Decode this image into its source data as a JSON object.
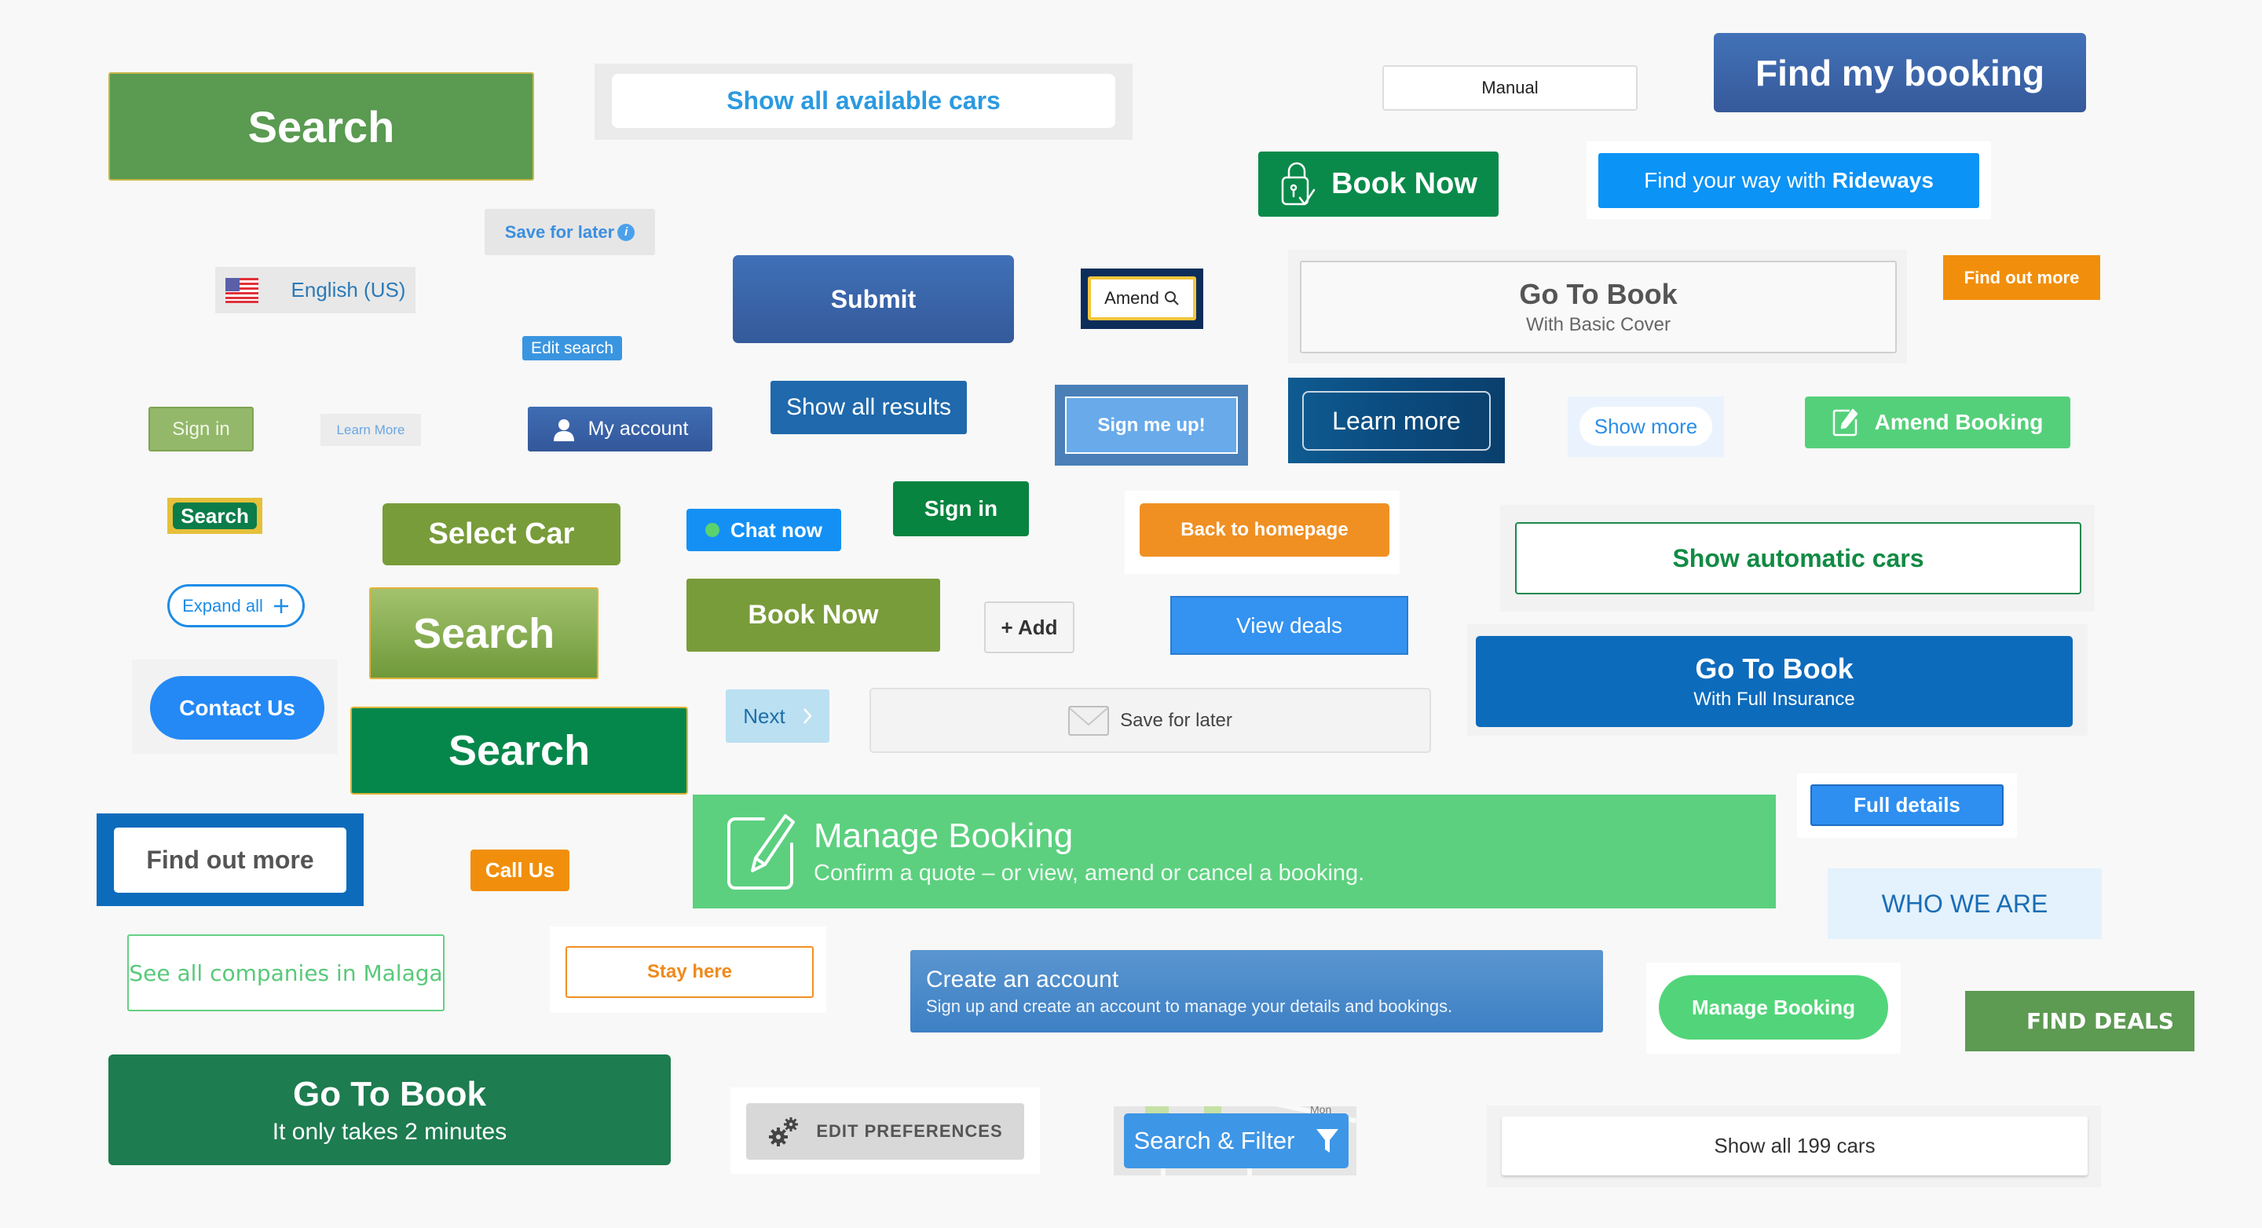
{
  "buttons": {
    "search_large": "Search",
    "show_all_available_cars": "Show all available cars",
    "manual": "Manual",
    "find_my_booking": "Find my booking",
    "book_now_lock": "Book Now",
    "rideways_prefix": "Find your way with ",
    "rideways_brand": "Rideways",
    "save_for_later_info": "Save for later",
    "info_glyph": "i",
    "language": "English (US)",
    "submit": "Submit",
    "amend": "Amend",
    "go_to_book_basic": {
      "title": "Go To Book",
      "subtitle": "With Basic Cover"
    },
    "find_out_more_orange": "Find out more",
    "edit_search": "Edit search",
    "sign_in_light": "Sign in",
    "learn_more_small": "Learn More",
    "my_account": "My account",
    "show_all_results": "Show all results",
    "sign_me_up": "Sign me up!",
    "learn_more_dark": "Learn more",
    "show_more": "Show more",
    "amend_booking": "Amend Booking",
    "search_yellow": "Search",
    "select_car": "Select Car",
    "chat_now": "Chat now",
    "sign_in_dark": "Sign in",
    "back_to_homepage": "Back to homepage",
    "show_automatic_cars": "Show automatic cars",
    "expand_all": "Expand all",
    "search_gradient": "Search",
    "book_now_olive": "Book Now",
    "add": "+ Add",
    "view_deals": "View deals",
    "go_to_book_full": {
      "title": "Go To Book",
      "subtitle": "With Full Insurance"
    },
    "contact_us": "Contact Us",
    "search_dark_green": "Search",
    "next": "Next",
    "save_for_later_envelope": "Save for later",
    "full_details": "Full details",
    "find_out_more_framed": "Find out more",
    "call_us": "Call Us",
    "manage_booking_banner": {
      "title": "Manage Booking",
      "subtitle": "Confirm a quote – or view, amend or cancel a booking."
    },
    "who_we_are": "WHO WE ARE",
    "see_all_companies": "See all companies in Malaga",
    "stay_here": "Stay here",
    "create_account": {
      "title": "Create an account",
      "subtitle": "Sign up and create an account to manage your details and bookings."
    },
    "manage_booking_pill": "Manage Booking",
    "find_deals": "FIND DEALS",
    "go_to_book_green": {
      "title": "Go To Book",
      "subtitle": "It only takes 2 minutes"
    },
    "edit_preferences": "EDIT PREFERENCES",
    "search_filter": "Search & Filter",
    "map_label_fragment": "Mon",
    "show_all_199_cars": "Show all 199 cars"
  },
  "icons": {
    "book_now_lock": "lock-check-icon",
    "save_for_later_info": "info-icon",
    "language": "us-flag-icon",
    "amend": "search-icon",
    "my_account": "user-icon",
    "amend_booking": "edit-icon",
    "chat_now": "online-dot-icon",
    "expand_all": "plus-icon",
    "next": "chevron-right-icon",
    "save_for_later_envelope": "envelope-icon",
    "manage_booking_banner": "edit-icon",
    "edit_preferences": "gears-icon",
    "search_filter": "filter-icon"
  },
  "colors": {
    "page_background": "#f8f8f8",
    "green_primary": "#5a9a51",
    "dark_green": "#05874b",
    "olive_green": "#799c3a",
    "mint_green": "#5cd07f",
    "royal_blue": "#36599a",
    "bright_blue": "#0b93f5",
    "corporate_blue": "#0d6bbc",
    "orange": "#f18f0c",
    "amend_yellow": "#f3c63c"
  }
}
